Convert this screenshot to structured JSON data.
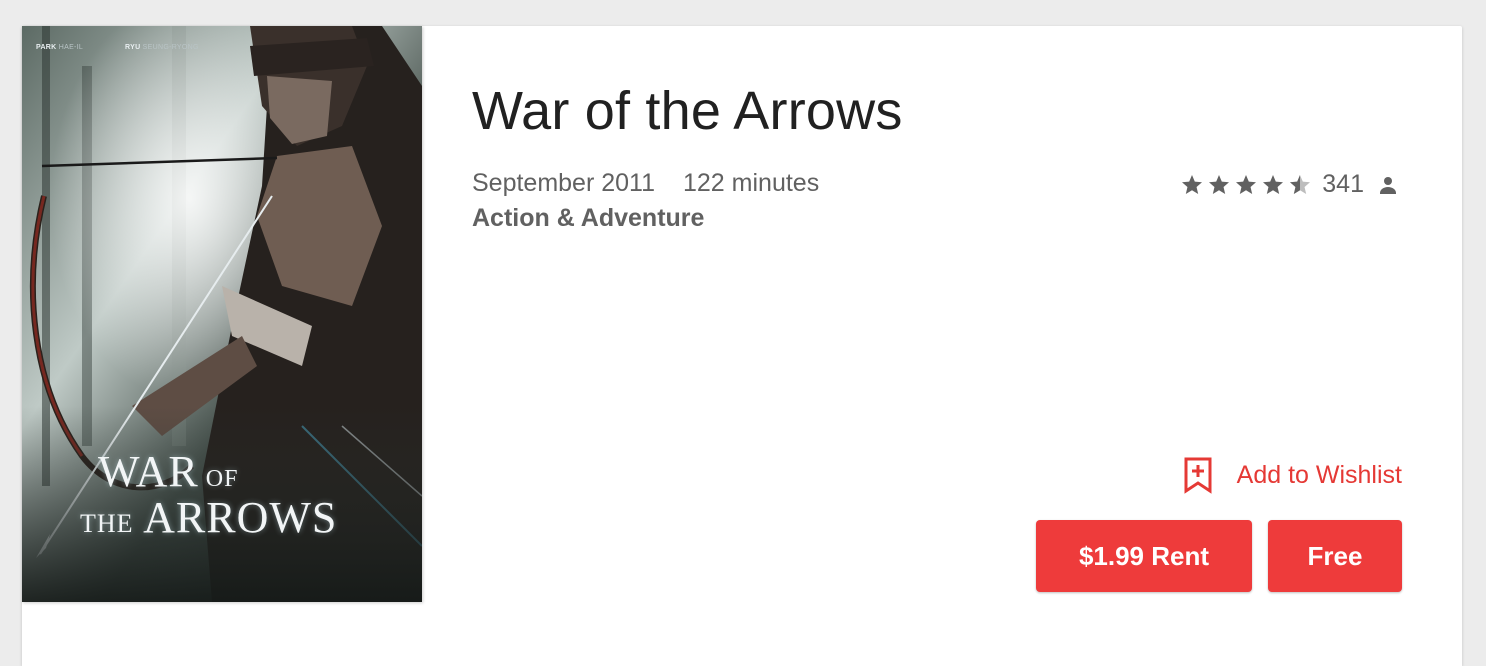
{
  "movie": {
    "title": "War of the Arrows",
    "release": "September 2011",
    "duration": "122 minutes",
    "genre": "Action & Adventure",
    "rating": 4.5,
    "rating_max": 5,
    "rating_count": "341"
  },
  "poster": {
    "credit_1_bold": "PARK",
    "credit_1_light": "HAE-IL",
    "credit_2_bold": "RYU",
    "credit_2_light": "SEUNG-RYONG",
    "title_line1_big": "WAR",
    "title_line1_small": " OF",
    "title_line2_small": "THE",
    "title_line2_big": " ARROWS"
  },
  "actions": {
    "wishlist_label": "Add to Wishlist",
    "rent_label": "$1.99 Rent",
    "free_label": "Free"
  },
  "colors": {
    "accent": "#e53935",
    "button": "#ee3b3b",
    "text_primary": "#212121",
    "text_secondary": "#616161"
  },
  "icons": {
    "star": "star-icon",
    "half_star": "star-half-icon",
    "person": "person-icon",
    "wishlist": "bookmark-add-icon"
  }
}
